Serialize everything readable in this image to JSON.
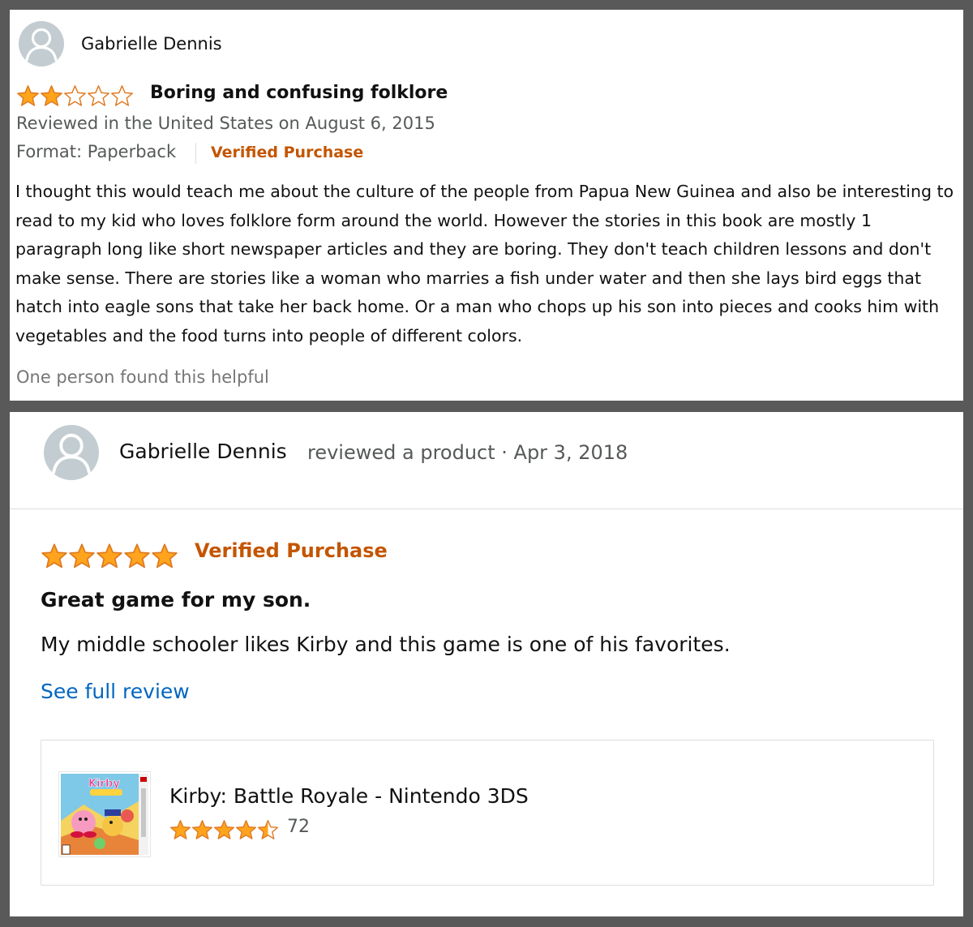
{
  "review1": {
    "reviewer_name": "Gabrielle Dennis",
    "rating": 2,
    "rating_max": 5,
    "title": "Boring and confusing folklore",
    "meta": "Reviewed in the United States on August 6, 2015",
    "format": "Format: Paperback",
    "verified": "Verified Purchase",
    "body": "I thought this would teach me about the culture of the people from Papua New Guinea and also be interesting to read to my kid who loves folklore form around the world. However the stories in this book are mostly 1 paragraph long like short newspaper articles and they are boring. They don't teach children lessons and don't make sense. There are stories like a woman who marries a fish under water and then she lays bird eggs that hatch into eagle sons that take her back home. Or a man who chops up his son into pieces and cooks him with vegetables and the food turns into people of different colors.",
    "helpful": "One person found this helpful"
  },
  "review2": {
    "reviewer_name": "Gabrielle Dennis",
    "subheading": "reviewed a product · Apr 3, 2018",
    "rating": 5,
    "rating_max": 5,
    "verified": "Verified Purchase",
    "title": "Great game for my son.",
    "body": "My middle schooler likes Kirby and this game is one of his favorites.",
    "see_full": "See full review",
    "product": {
      "title": "Kirby: Battle Royale - Nintendo 3DS",
      "rating": 4.5,
      "rating_count": "72",
      "image_icon": "kirby-box-art-thumbnail"
    }
  },
  "colors": {
    "star_fill": "#ffa41c",
    "star_stroke": "#de7921",
    "verified": "#c45500",
    "link": "#0066c0",
    "muted": "#565959",
    "frame": "#595959"
  },
  "icons": {
    "avatar": "user-silhouette-icon",
    "star": "star-icon"
  }
}
